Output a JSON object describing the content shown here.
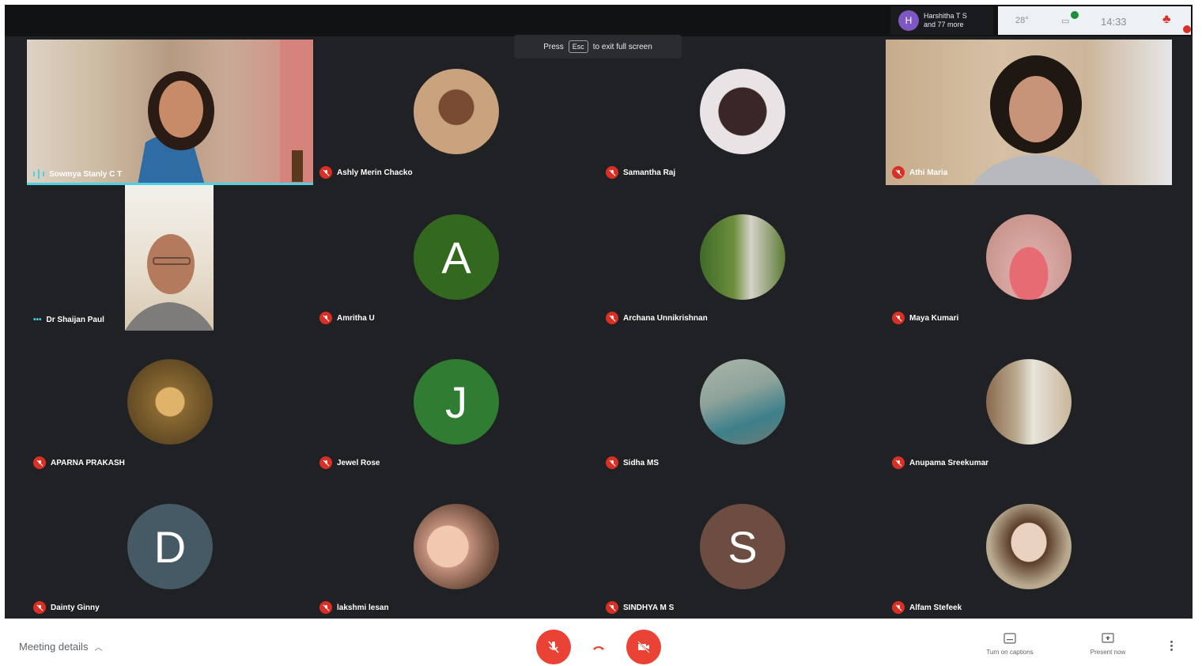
{
  "toast": {
    "press": "Press",
    "key": "Esc",
    "rest": "to exit full screen"
  },
  "presence": {
    "initial": "H",
    "line1": "Harshitha T S",
    "line2": "and 77 more"
  },
  "tray": {
    "temp": "28°",
    "chat_count": "9",
    "time": "14:33",
    "notif_count": "9"
  },
  "participants": [
    {
      "name": "Sowmya Stanly C T",
      "kind": "video",
      "speaking": true
    },
    {
      "name": "Ashly Merin Chacko",
      "kind": "photo",
      "muted": true,
      "bg": "#c9a27e"
    },
    {
      "name": "Samantha Raj",
      "kind": "photo",
      "muted": true,
      "bg": "#e9e3e5"
    },
    {
      "name": "Athi Maria",
      "kind": "video",
      "muted": true
    },
    {
      "name": "Dr Shaijan Paul",
      "kind": "video2",
      "speaking": false
    },
    {
      "name": "Amritha U",
      "kind": "letter",
      "letter": "A",
      "color": "#33691e",
      "muted": true
    },
    {
      "name": "Archana Unnikrishnan",
      "kind": "photo",
      "muted": true,
      "bg": "#6d8e3b"
    },
    {
      "name": "Maya Kumari",
      "kind": "photo",
      "muted": true,
      "bg": "#d9a7a3"
    },
    {
      "name": "APARNA PRAKASH",
      "kind": "photo",
      "muted": true,
      "bg": "#8a6a32"
    },
    {
      "name": "Jewel Rose",
      "kind": "letter",
      "letter": "J",
      "color": "#2e7d32",
      "muted": true
    },
    {
      "name": "Sidha MS",
      "kind": "photo",
      "muted": true,
      "bg": "#8fa39b"
    },
    {
      "name": "Anupama Sreekumar",
      "kind": "photo",
      "muted": true,
      "bg": "#b9a88b"
    },
    {
      "name": "Dainty Ginny",
      "kind": "letter",
      "letter": "D",
      "color": "#455a64",
      "muted": true
    },
    {
      "name": "lakshmi lesan",
      "kind": "photo",
      "muted": true,
      "bg": "#c4917d"
    },
    {
      "name": "SINDHYA M S",
      "kind": "letter",
      "letter": "S",
      "color": "#6d4c41",
      "muted": true
    },
    {
      "name": "Alfam Stefeek",
      "kind": "photo",
      "muted": true,
      "bg": "#b9a98f"
    }
  ],
  "bottom": {
    "details": "Meeting details",
    "captions": "Turn on captions",
    "present": "Present now"
  }
}
